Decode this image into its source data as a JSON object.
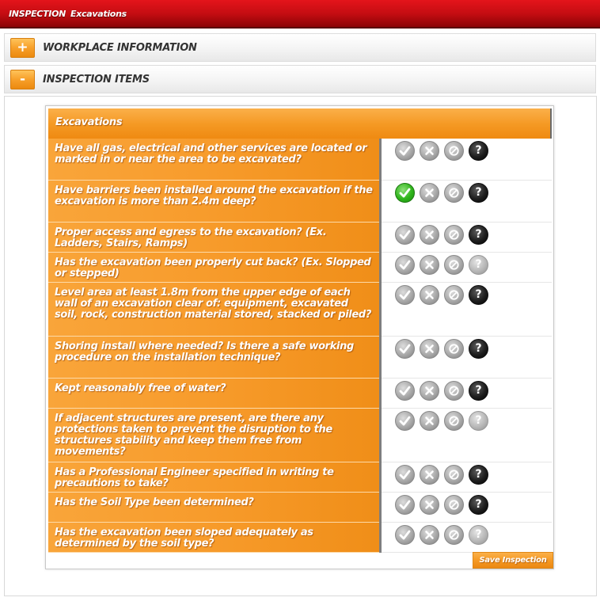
{
  "breadcrumb": {
    "section": "INSPECTION",
    "page": "Excavations"
  },
  "sections": [
    {
      "toggle": "+",
      "label": "WORKPLACE INFORMATION"
    },
    {
      "toggle": "-",
      "label": "INSPECTION ITEMS"
    }
  ],
  "card": {
    "title": "Excavations"
  },
  "answer_icons": [
    "check-icon",
    "x-icon",
    "not-applicable-icon",
    "help-icon"
  ],
  "colors": {
    "accent": "#f59a25",
    "header_red": "#c50d12",
    "selected_yes": "#2fb51b"
  },
  "items": [
    {
      "question": "Have all gas, electrical and other services are located or marked in or near the area to be excavated?",
      "selected": "none",
      "help": "dark"
    },
    {
      "question": "Have barriers been installed around the excavation if the excavation is more than 2.4m deep?",
      "selected": "yes",
      "help": "dark"
    },
    {
      "question": "Proper access and egress to the excavation? (Ex. Ladders, Stairs, Ramps)",
      "selected": "none",
      "help": "dark"
    },
    {
      "question": "Has the excavation been properly cut back? (Ex. Slopped or stepped)",
      "selected": "none",
      "help": "light"
    },
    {
      "question": "Level area at least 1.8m from the upper edge of each wall of an excavation clear of: equipment, excavated soil, rock, construction material stored, stacked or piled?",
      "selected": "none",
      "help": "dark"
    },
    {
      "question": "Shoring install where needed? Is there a safe working procedure on the installation technique?",
      "selected": "none",
      "help": "dark"
    },
    {
      "question": "Kept reasonably free of water?",
      "selected": "none",
      "help": "dark"
    },
    {
      "question": "If adjacent structures are present, are there any protections taken to prevent the disruption to the structures stability and keep them free from movements?",
      "selected": "none",
      "help": "light"
    },
    {
      "question": "Has a Professional Engineer specified in writing te precautions to take?",
      "selected": "none",
      "help": "dark"
    },
    {
      "question": "Has the Soil Type been determined?",
      "selected": "none",
      "help": "dark"
    },
    {
      "question": "Has the excavation been sloped adequately as determined by the soil type?",
      "selected": "none",
      "help": "light"
    }
  ],
  "save_label": "Save Inspection"
}
